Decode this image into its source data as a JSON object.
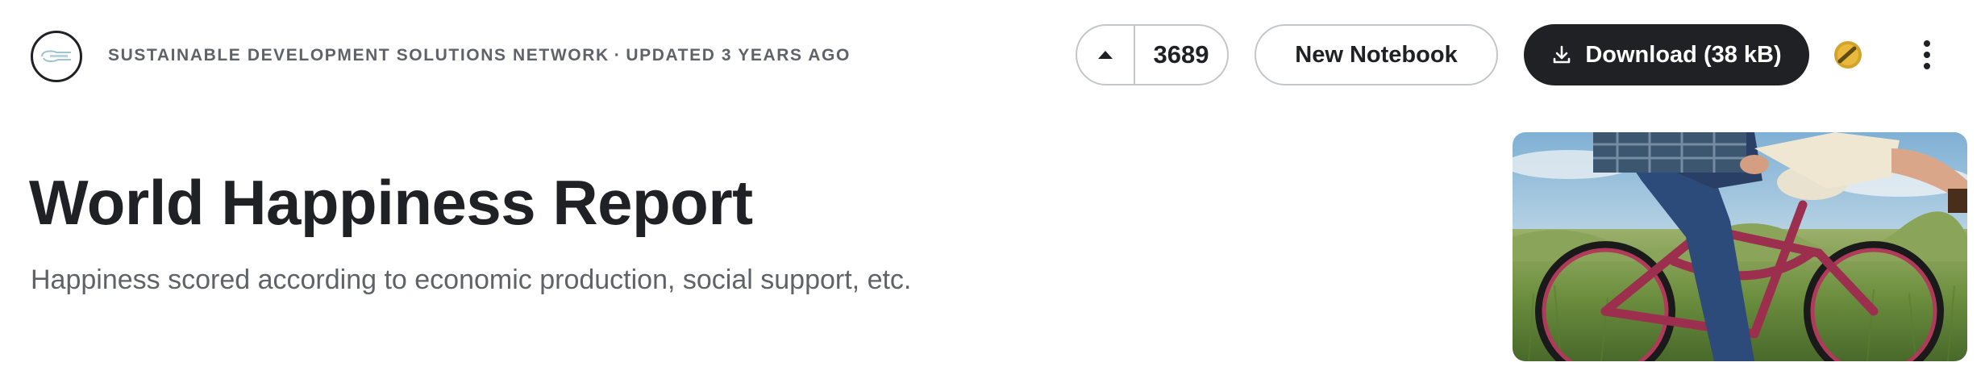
{
  "header": {
    "owner": "SUSTAINABLE DEVELOPMENT SOLUTIONS NETWORK",
    "separator": "·",
    "updated": "UPDATED 3 YEARS AGO"
  },
  "vote": {
    "count": "3689",
    "icon": "triangle-up-icon"
  },
  "actions": {
    "new_notebook": "New Notebook",
    "download": "Download (38 kB)",
    "download_icon": "download-icon",
    "medal_icon": "gold-medal-icon",
    "more_icon": "more-vertical-icon"
  },
  "dataset": {
    "title": "World Happiness Report",
    "subtitle": "Happiness scored according to economic production, social support, etc."
  },
  "colors": {
    "primary_dark": "#202124",
    "muted_text": "#5f6368",
    "border": "#c4c7c9",
    "medal_gold": "#d6a32a"
  }
}
